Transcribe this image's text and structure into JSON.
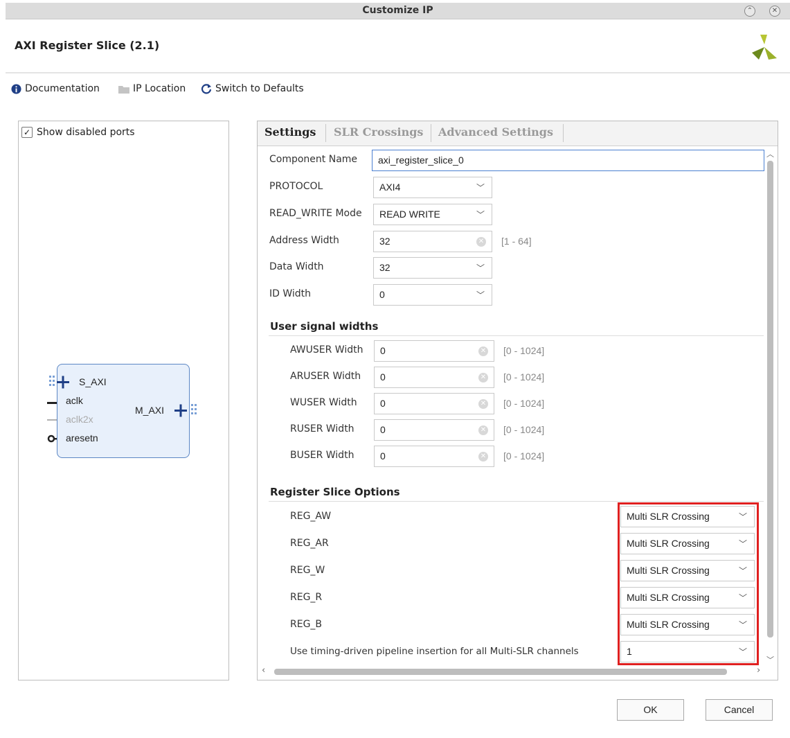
{
  "window": {
    "title": "Customize IP",
    "minimize_icon": "⌃",
    "close_icon": "✕"
  },
  "header": {
    "ip_title": "AXI Register Slice (2.1)",
    "logo": "xilinx-logo"
  },
  "toolbar": {
    "documentation": "Documentation",
    "ip_location": "IP Location",
    "switch_defaults": "Switch to Defaults"
  },
  "left": {
    "show_disabled_ports": "Show disabled ports",
    "ports": {
      "s_axi": "S_AXI",
      "aclk": "aclk",
      "aclk2x": "aclk2x",
      "aresetn": "aresetn",
      "m_axi": "M_AXI"
    }
  },
  "tabs": [
    {
      "label": "Settings",
      "active": true
    },
    {
      "label": "SLR Crossings",
      "active": false
    },
    {
      "label": "Advanced Settings",
      "active": false
    }
  ],
  "settings": {
    "component_name": {
      "label": "Component Name",
      "value": "axi_register_slice_0"
    },
    "protocol": {
      "label": "PROTOCOL",
      "value": "AXI4"
    },
    "read_write_mode": {
      "label": "READ_WRITE Mode",
      "value": "READ WRITE"
    },
    "address_width": {
      "label": "Address Width",
      "value": "32",
      "range": "[1 - 64]"
    },
    "data_width": {
      "label": "Data Width",
      "value": "32"
    },
    "id_width": {
      "label": "ID Width",
      "value": "0"
    }
  },
  "user_signal": {
    "title": "User signal widths",
    "rows": [
      {
        "label": "AWUSER Width",
        "value": "0",
        "range": "[0 - 1024]"
      },
      {
        "label": "ARUSER Width",
        "value": "0",
        "range": "[0 - 1024]"
      },
      {
        "label": "WUSER Width",
        "value": "0",
        "range": "[0 - 1024]"
      },
      {
        "label": "RUSER Width",
        "value": "0",
        "range": "[0 - 1024]"
      },
      {
        "label": "BUSER Width",
        "value": "0",
        "range": "[0 - 1024]"
      }
    ]
  },
  "register_slice": {
    "title": "Register Slice Options",
    "rows": [
      {
        "label": "REG_AW",
        "value": "Multi SLR Crossing"
      },
      {
        "label": "REG_AR",
        "value": "Multi SLR Crossing"
      },
      {
        "label": "REG_W",
        "value": "Multi SLR Crossing"
      },
      {
        "label": "REG_R",
        "value": "Multi SLR Crossing"
      },
      {
        "label": "REG_B",
        "value": "Multi SLR Crossing"
      },
      {
        "label": "Use timing-driven pipeline insertion for all Multi-SLR channels",
        "value": "1"
      }
    ],
    "highlight_color": "#e02020"
  },
  "buttons": {
    "ok": "OK",
    "cancel": "Cancel"
  }
}
